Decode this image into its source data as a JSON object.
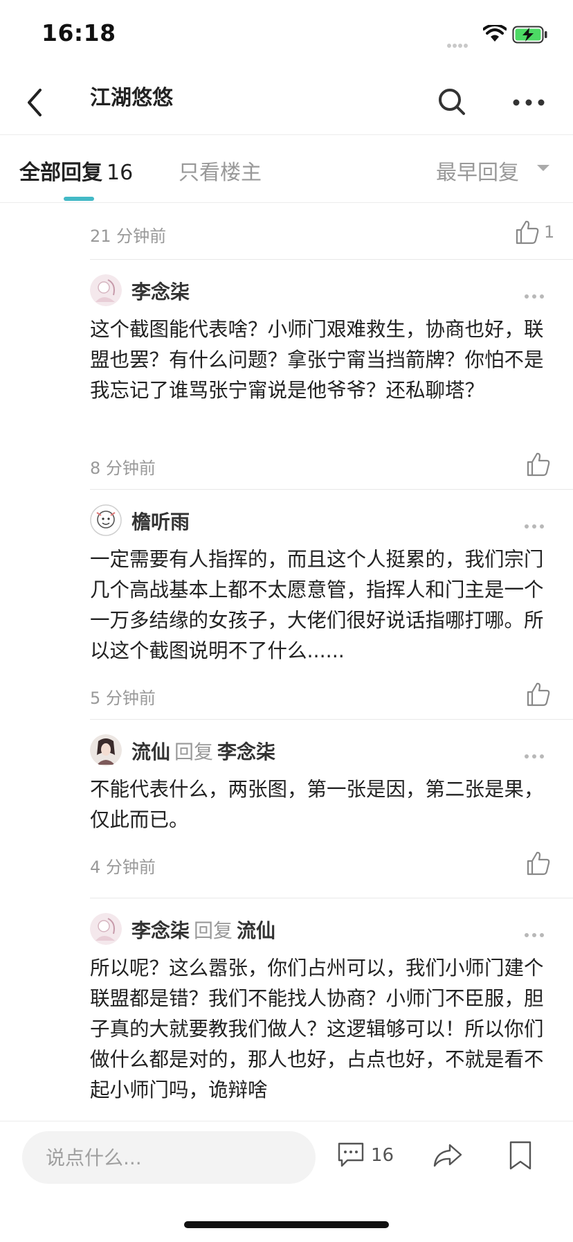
{
  "status_bar": {
    "time": "16:18"
  },
  "nav": {
    "title": "江湖悠悠"
  },
  "tabs": {
    "all_label": "全部回复",
    "all_count": "16",
    "owner_only_label": "只看楼主",
    "sort_label": "最早回复"
  },
  "top_item": {
    "time": "21 分钟前",
    "like_count": "1"
  },
  "comments": [
    {
      "author": "李念柒",
      "reply_word": "",
      "reply_target": "",
      "body": "这个截图能代表啥？小师门艰难救生，协商也好，联盟也罢？有什么问题？拿张宁甯当挡箭牌？你怕不是我忘记了谁骂张宁甯说是他爷爷？还私聊塔？",
      "time": "8 分钟前"
    },
    {
      "author": "檐听雨",
      "reply_word": "",
      "reply_target": "",
      "body": "一定需要有人指挥的，而且这个人挺累的，我们宗门几个高战基本上都不太愿意管，指挥人和门主是一个一万多结缘的女孩子，大佬们很好说话指哪打哪。所以这个截图说明不了什么......",
      "time": "5 分钟前"
    },
    {
      "author": "流仙",
      "reply_word": "回复",
      "reply_target": "李念柒",
      "body": "不能代表什么，两张图，第一张是因，第二张是果，仅此而已。",
      "time": "4 分钟前"
    },
    {
      "author": "李念柒",
      "reply_word": "回复",
      "reply_target": "流仙",
      "body": "所以呢？这么嚣张，你们占州可以，我们小师门建个联盟都是错？我们不能找人协商？小师门不臣服，胆子真的大就要教我们做人？这逻辑够可以！所以你们做什么都是对的，那人也好，占点也好，不就是看不起小师门吗，诡辩啥",
      "time": ""
    }
  ],
  "bottom_bar": {
    "input_placeholder": "说点什么...",
    "comments_count": "16"
  }
}
